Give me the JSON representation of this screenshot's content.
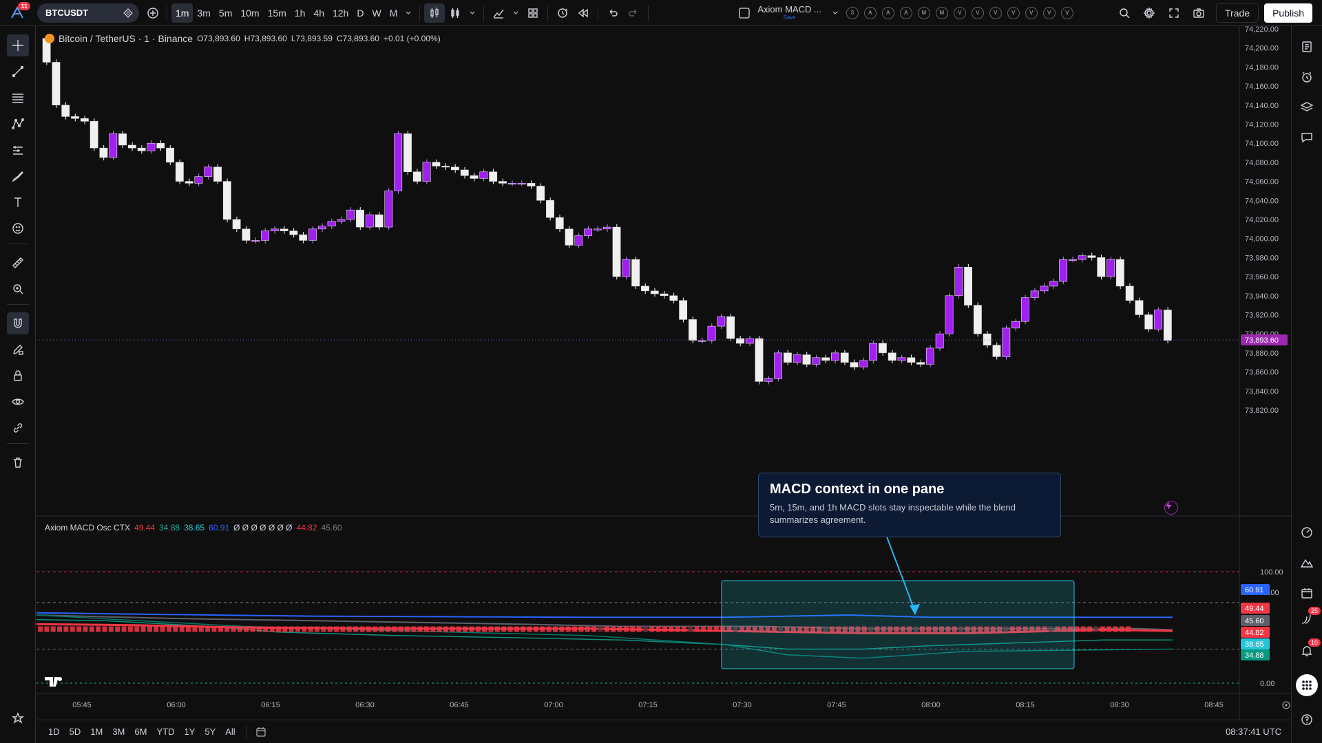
{
  "topbar": {
    "notif_count": "11",
    "symbol": "BTCUSDT",
    "timeframes": [
      "1m",
      "3m",
      "5m",
      "10m",
      "15m",
      "1h",
      "4h",
      "12h",
      "D",
      "W",
      "M"
    ],
    "active_timeframe": "1m",
    "layout_name": "Axiom MACD ...",
    "layout_save": "Save",
    "alert_chips": [
      "3",
      "A",
      "A",
      "A",
      "M",
      "M",
      "V",
      "V",
      "V",
      "V",
      "V",
      "V",
      "V"
    ],
    "trade_label": "Trade",
    "publish_label": "Publish"
  },
  "legend": {
    "title": "Bitcoin / TetherUS · 1 · Binance",
    "open": "O73,893.60",
    "high": "H73,893.60",
    "low": "L73,893.59",
    "close": "C73,893.60",
    "change": "+0.01 (+0.00%)"
  },
  "indicator_legend": {
    "name": "Axiom MACD Osc CTX",
    "values": [
      {
        "v": "49.44",
        "color": "#f23645"
      },
      {
        "v": "34.88",
        "color": "#22ab94"
      },
      {
        "v": "38.65",
        "color": "#26c6da"
      },
      {
        "v": "60.91",
        "color": "#2962ff"
      },
      {
        "v": "Ø Ø Ø Ø Ø Ø Ø",
        "color": "#d1d4dc"
      },
      {
        "v": "44.82",
        "color": "#f23645"
      },
      {
        "v": "45.60",
        "color": "#787b86"
      }
    ]
  },
  "price_axis": [
    "74,220.00",
    "74,200.00",
    "74,180.00",
    "74,160.00",
    "74,140.00",
    "74,120.00",
    "74,100.00",
    "74,080.00",
    "74,060.00",
    "74,040.00",
    "74,020.00",
    "74,000.00",
    "73,980.00",
    "73,960.00",
    "73,940.00",
    "73,920.00",
    "73,900.00",
    "73,880.00",
    "73,860.00",
    "73,840.00",
    "73,820.00"
  ],
  "current_price": "73,893.60",
  "osc_axis": [
    "100.00",
    "80.00",
    "0.00"
  ],
  "osc_tags": [
    {
      "v": "60.91",
      "bg": "#2962ff"
    },
    {
      "v": "49.44",
      "bg": "#f23645"
    },
    {
      "v": "45.60",
      "bg": "#5d606b"
    },
    {
      "v": "44.82",
      "bg": "#f23645"
    },
    {
      "v": "38.65",
      "bg": "#26c6da"
    },
    {
      "v": "34.88",
      "bg": "#089981"
    }
  ],
  "time_axis": [
    "05:45",
    "06:00",
    "06:15",
    "06:30",
    "06:45",
    "07:00",
    "07:15",
    "07:30",
    "07:45",
    "08:00",
    "08:15",
    "08:30",
    "08:45"
  ],
  "callout": {
    "title": "MACD context in one pane",
    "body": "5m, 15m, and 1h MACD slots stay inspectable while the blend summarizes agreement."
  },
  "bottom": {
    "ranges": [
      "1D",
      "5D",
      "1M",
      "3M",
      "6M",
      "YTD",
      "1Y",
      "5Y",
      "All"
    ],
    "clock": "08:37:41 UTC"
  },
  "right_badges": {
    "a": "25",
    "b": "10"
  },
  "chart_data": {
    "type": "candlestick",
    "close": [
      74185,
      74140,
      74128,
      74126,
      74123,
      74095,
      74085,
      74110,
      74098,
      74095,
      74092,
      74100,
      74095,
      74080,
      74060,
      74058,
      74065,
      74075,
      74060,
      74020,
      74010,
      73998,
      73998,
      74008,
      74010,
      74008,
      74004,
      73998,
      74010,
      74013,
      74018,
      74020,
      74030,
      74012,
      74025,
      74012,
      74050,
      74110,
      74070,
      74060,
      74080,
      74076,
      74075,
      74072,
      74066,
      74063,
      74070,
      74060,
      74058,
      74058,
      74058,
      74055,
      74040,
      74022,
      74010,
      73993,
      74003,
      74010,
      74010,
      74012,
      73960,
      73978,
      73950,
      73945,
      73942,
      73940,
      73935,
      73915,
      73893,
      73893,
      73908,
      73918,
      73895,
      73890,
      73895,
      73850,
      73853,
      73880,
      73870,
      73878,
      73868,
      73875,
      73872,
      73880,
      73870,
      73865,
      73872,
      73890,
      73880,
      73872,
      73875,
      73870,
      73868,
      73885,
      73900,
      73940,
      73970,
      73930,
      73900,
      73888,
      73876,
      73906,
      73913,
      73938,
      73945,
      73950,
      73955,
      73978,
      73978,
      73982,
      73980,
      73960,
      73978,
      73950,
      73935,
      73920,
      73905,
      73925,
      73893
    ],
    "ylim": [
      73820,
      74220
    ]
  }
}
